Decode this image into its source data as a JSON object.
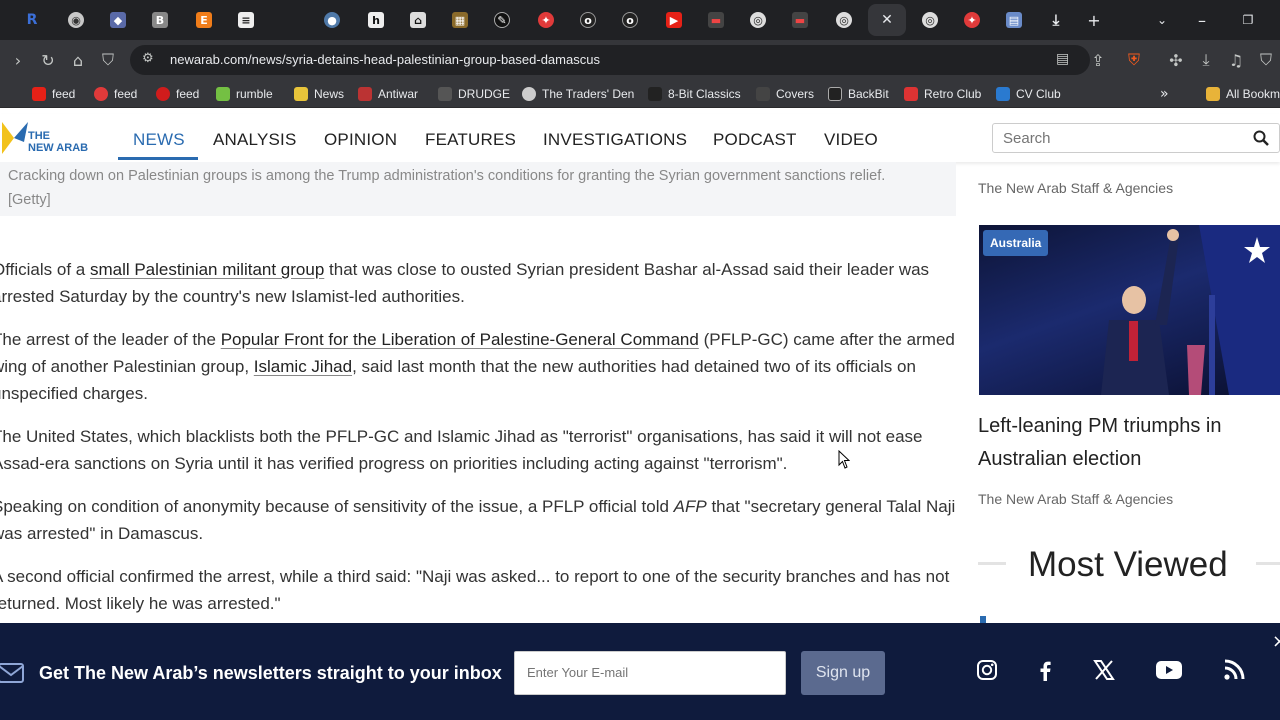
{
  "browser": {
    "url": "newarab.com/news/syria-detains-head-palestinian-group-based-damascus",
    "bookmarks": [
      "feed",
      "feed",
      "feed",
      "rumble",
      "News",
      "Antiwar",
      "DRUDGE",
      "The Traders' Den",
      "8-Bit Classics",
      "Covers",
      "BackBit",
      "Retro Club",
      "CV Club",
      "All Bookm"
    ]
  },
  "site": {
    "logo_line1": "THE",
    "logo_line2": "NEW ARAB",
    "nav": [
      "NEWS",
      "ANALYSIS",
      "OPINION",
      "FEATURES",
      "INVESTIGATIONS",
      "PODCAST",
      "VIDEO"
    ],
    "search_placeholder": "Search"
  },
  "caption": "Cracking down on Palestinian groups is among the Trump administration's conditions for granting the Syrian government sanctions relief. [Getty]",
  "article": {
    "p1_pre": "Officials of a ",
    "p1_link": "small Palestinian militant group",
    "p1_post": " that was close to ousted Syrian president Bashar al-Assad said their leader was arrested Saturday by the country's new Islamist-led authorities.",
    "p2_pre": "The arrest of the leader of the ",
    "p2_link1": "Popular Front for the Liberation of Palestine-General Command",
    "p2_mid": " (PFLP-GC) came after the armed wing of another Palestinian group, ",
    "p2_link2": "Islamic Jihad",
    "p2_post": ", said last month that the new authorities had detained two of its officials on unspecified charges.",
    "p3": "The United States, which blacklists both the PFLP-GC and Islamic Jihad as \"terrorist\" organisations, has said it will not ease Assad-era sanctions on Syria until it has verified progress on priorities including acting against \"terrorism\".",
    "p4_pre": "Speaking on condition of anonymity because of sensitivity of the issue, a PFLP official told ",
    "p4_em": "AFP",
    "p4_post": " that \"secretary general Talal Naji was arrested\" in Damascus.",
    "p5": "A second official confirmed the arrest, while a third said: \"Naji was asked... to report to one of the security branches and has not returned. Most likely he was arrested.\""
  },
  "sidebar": {
    "byline_top": "The New Arab Staff & Agencies",
    "badge": "Australia",
    "card_title": "Left-leaning PM triumphs in Australian election",
    "card_byline": "The New Arab Staff & Agencies",
    "most_viewed": "Most Viewed"
  },
  "newsletter": {
    "text": "Get The New Arab’s newsletters straight to your inbox",
    "email_placeholder": "Enter Your E-mail",
    "button": "Sign up"
  }
}
